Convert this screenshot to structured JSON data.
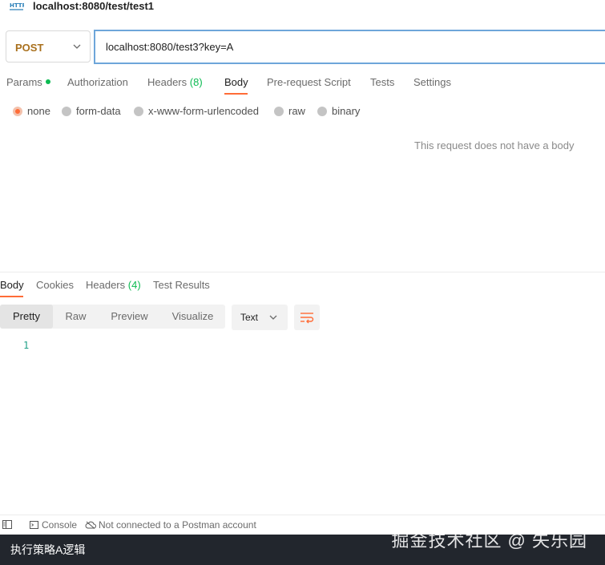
{
  "window": {
    "title": "localhost:8080/test/test1",
    "title_icon": "http-request-icon"
  },
  "request": {
    "method": "POST",
    "url": "localhost:8080/test3?key=A",
    "tabs": [
      {
        "label": "Params",
        "has_dot": true
      },
      {
        "label": "Authorization"
      },
      {
        "label": "Headers",
        "count": "(8)"
      },
      {
        "label": "Body",
        "active": true
      },
      {
        "label": "Pre-request Script"
      },
      {
        "label": "Tests"
      },
      {
        "label": "Settings"
      }
    ],
    "body_types": [
      {
        "label": "none",
        "selected": true
      },
      {
        "label": "form-data"
      },
      {
        "label": "x-www-form-urlencoded"
      },
      {
        "label": "raw"
      },
      {
        "label": "binary"
      }
    ],
    "empty_body_message": "This request does not have a body"
  },
  "response": {
    "tabs": [
      {
        "label": "Body",
        "active": true
      },
      {
        "label": "Cookies"
      },
      {
        "label": "Headers",
        "count": "(4)"
      },
      {
        "label": "Test Results"
      }
    ],
    "view_modes": [
      {
        "label": "Pretty",
        "active": true
      },
      {
        "label": "Raw"
      },
      {
        "label": "Preview"
      },
      {
        "label": "Visualize"
      }
    ],
    "format": "Text",
    "line_number": "1"
  },
  "status_bar": {
    "console_label": "Console",
    "connection_label": "Not connected to a Postman account"
  },
  "console_output": "执行策略A逻辑",
  "watermark": "掘金技术社区 @ 失乐园",
  "colors": {
    "accent": "#ff6c37",
    "method": "#a9701d",
    "url_border": "#6ea6da",
    "green": "#0cbb52"
  }
}
